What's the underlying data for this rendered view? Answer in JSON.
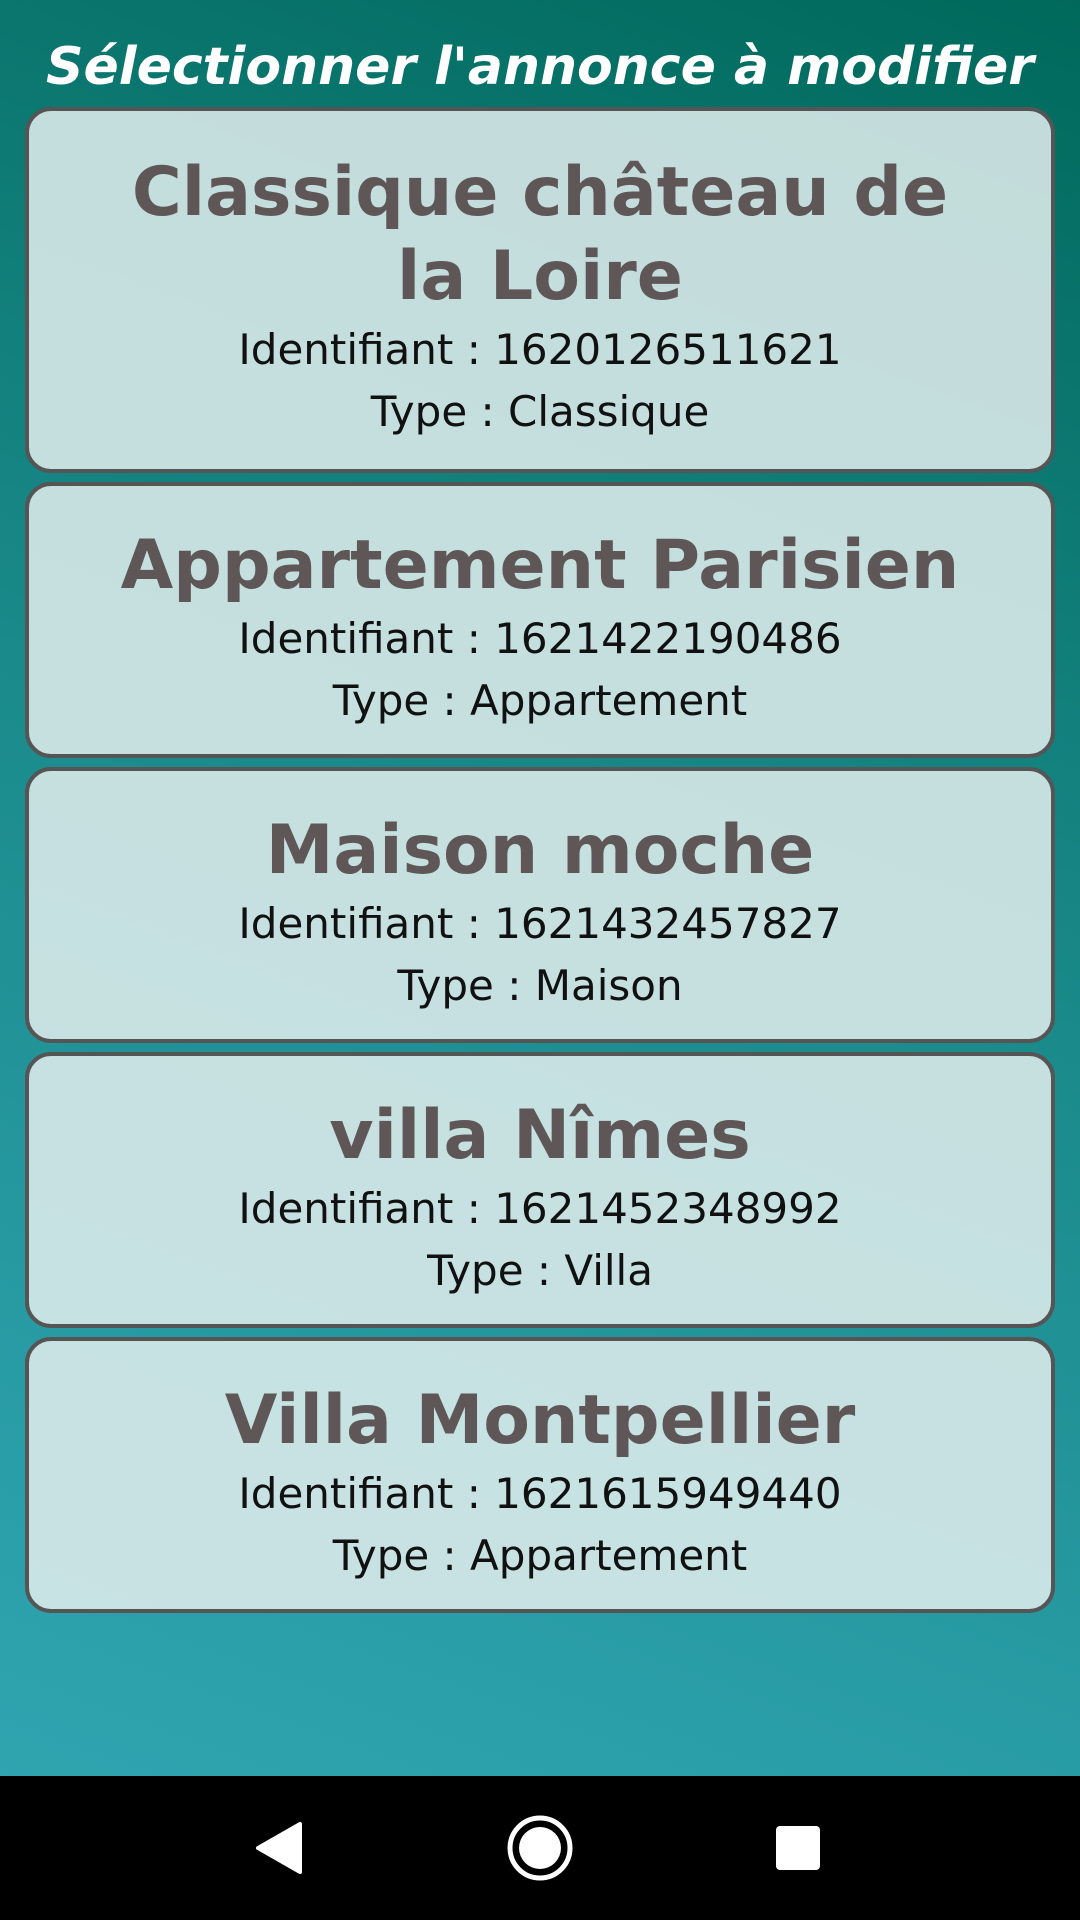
{
  "header": {
    "title": "Sélectionner l'annonce à modifier"
  },
  "listings": [
    {
      "title": "Classique château de la Loire",
      "id_line": "Identifiant : 1620126511621",
      "type_line": "Type : Classique"
    },
    {
      "title": "Appartement Parisien",
      "id_line": "Identifiant : 1621422190486",
      "type_line": "Type : Appartement"
    },
    {
      "title": "Maison moche",
      "id_line": "Identifiant : 1621432457827",
      "type_line": "Type : Maison"
    },
    {
      "title": "villa Nîmes",
      "id_line": "Identifiant : 1621452348992",
      "type_line": "Type : Villa"
    },
    {
      "title": "Villa Montpellier",
      "id_line": "Identifiant : 1621615949440",
      "type_line": "Type : Appartement"
    }
  ],
  "navbar": {
    "back_icon": "back-triangle-icon",
    "home_icon": "home-circle-icon",
    "recents_icon": "recents-square-icon"
  },
  "colors": {
    "background_top": "#00695c",
    "background_bottom": "#32a6b2",
    "card_border": "#555555",
    "card_title": "#5f5757",
    "navbar": "#000000"
  }
}
